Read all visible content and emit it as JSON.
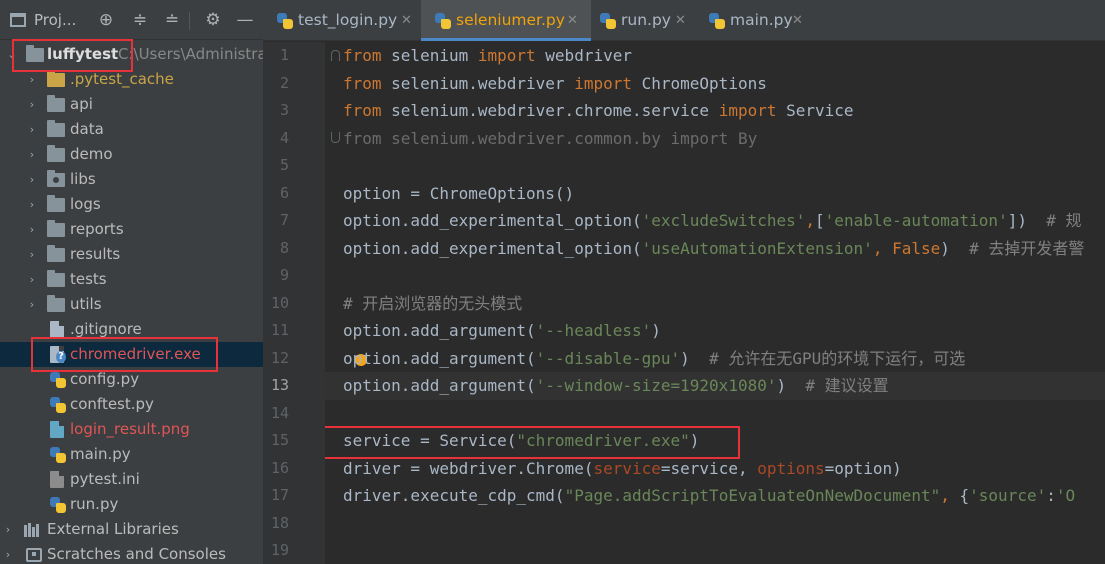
{
  "project_panel": {
    "title": "Proj...",
    "toolbar_icons": [
      "add-icon",
      "collapse-all-icon",
      "expand-all-icon",
      "settings-icon",
      "hide-icon"
    ],
    "root": {
      "name": "luffytest",
      "path": "C:\\Users\\Administra"
    },
    "items": [
      {
        "name": ".pytest_cache",
        "kind": "folder-excluded"
      },
      {
        "name": "api",
        "kind": "folder"
      },
      {
        "name": "data",
        "kind": "folder"
      },
      {
        "name": "demo",
        "kind": "folder"
      },
      {
        "name": "libs",
        "kind": "folder"
      },
      {
        "name": "logs",
        "kind": "folder"
      },
      {
        "name": "reports",
        "kind": "folder"
      },
      {
        "name": "results",
        "kind": "folder"
      },
      {
        "name": "tests",
        "kind": "folder"
      },
      {
        "name": "utils",
        "kind": "folder"
      },
      {
        "name": ".gitignore",
        "kind": "file"
      },
      {
        "name": "chromedriver.exe",
        "kind": "file-unknown"
      },
      {
        "name": "config.py",
        "kind": "python"
      },
      {
        "name": "conftest.py",
        "kind": "python"
      },
      {
        "name": "login_result.png",
        "kind": "image"
      },
      {
        "name": "main.py",
        "kind": "python"
      },
      {
        "name": "pytest.ini",
        "kind": "ini"
      },
      {
        "name": "run.py",
        "kind": "python"
      }
    ],
    "external_libraries": "External Libraries",
    "scratches": "Scratches and Consoles"
  },
  "tabs": [
    {
      "label": "test_login.py",
      "active": false
    },
    {
      "label": "seleniumer.py",
      "active": true
    },
    {
      "label": "run.py",
      "active": false
    },
    {
      "label": "main.py",
      "active": false
    }
  ],
  "editor": {
    "current_line": 13,
    "line_numbers": [
      "1",
      "2",
      "3",
      "4",
      "5",
      "6",
      "7",
      "8",
      "9",
      "10",
      "11",
      "12",
      "13",
      "14",
      "15",
      "16",
      "17",
      "18",
      "19"
    ],
    "lines": {
      "l1": {
        "kw1": "from",
        "t1": " selenium ",
        "kw2": "import",
        "t2": " webdriver"
      },
      "l2": {
        "kw1": "from",
        "t1": " selenium.webdriver ",
        "kw2": "import",
        "t2": " ChromeOptions"
      },
      "l3": {
        "kw1": "from",
        "t1": " selenium.webdriver.chrome.service ",
        "kw2": "import",
        "t2": " Service"
      },
      "l4": {
        "text": "from selenium.webdriver.common.by import By"
      },
      "l6": {
        "text": "option = ChromeOptions()"
      },
      "l7": {
        "t1": "option.add_experimental_option(",
        "s1": "'excludeSwitches'",
        "p1": ",",
        "t2": "[",
        "s2": "'enable-automation'",
        "t3": "])  ",
        "c1": "# 规"
      },
      "l8": {
        "t1": "option.add_experimental_option(",
        "s1": "'useAutomationExtension'",
        "p1": ", ",
        "kw1": "False",
        "t2": ")  ",
        "c1": "# 去掉开发者警"
      },
      "l10": {
        "c1": "# 开启浏览器的无头模式"
      },
      "l11": {
        "t1": "option.add_argument(",
        "s1": "'--headless'",
        "t2": ")"
      },
      "l12": {
        "t1": "option.add_argument(",
        "s1": "'--disable-gpu'",
        "t2": ")  ",
        "c1": "# 允许在无GPU的环境下运行，可选"
      },
      "l13": {
        "t1": "option.add_argument(",
        "s1": "'--window-size=1920x1080'",
        "t2": ")  ",
        "c1": "# 建议设置"
      },
      "l15": {
        "t1": "service = Service(",
        "s1": "\"chromedriver.exe\"",
        "t2": ")"
      },
      "l16": {
        "t1": "driver = webdriver.Chrome(",
        "pa1": "service",
        "t2": "=service, ",
        "pa2": "options",
        "t3": "=option)"
      },
      "l17": {
        "t1": "driver.execute_cdp_cmd(",
        "s1": "\"Page.addScriptToEvaluateOnNewDocument\"",
        "p1": ", ",
        "t2": "{",
        "s2": "'source'",
        "t3": ":",
        "s3": "'O"
      }
    }
  },
  "colors": {
    "keyword": "#cc7832",
    "string": "#6a8759",
    "comment": "#808080",
    "highlight_box": "#e8323a",
    "selection": "#0d293e"
  }
}
